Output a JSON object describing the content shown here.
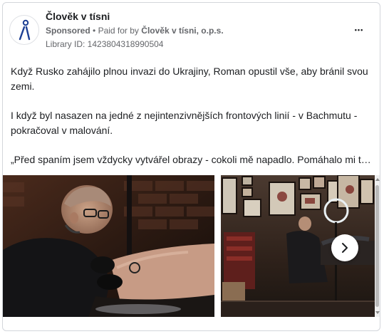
{
  "post": {
    "page_name": "Člověk v tísni",
    "sponsored_label": "Sponsored",
    "separator": "•",
    "paid_for_prefix": "Paid for by",
    "paid_for_name": "Člověk v tísni, o.p.s.",
    "library_id": "Library ID: 1423804318990504",
    "more_icon": "more-horizontal-icon",
    "more_label": "•••",
    "body": [
      "Když Rusko zahájilo plnou invazi do Ukrajiny, Roman opustil vše, aby bránil svou zemi.",
      "I když byl nasazen na jedné z nejintenzivnějších frontových linií - v Bachmutu - pokračoval v malování.",
      "„Před spaním jsem vždycky vytvářel obrazy - cokoli mě napadlo. Pomáhalo mi to..."
    ]
  },
  "carousel": {
    "next_icon": "chevron-right-icon",
    "slides": [
      {
        "name": "tattoo-artist-working-photo"
      },
      {
        "name": "tattoo-studio-interior-photo"
      }
    ]
  },
  "colors": {
    "text": "#1c1e21",
    "secondary_text": "#65676b",
    "border": "#d3d6db"
  }
}
